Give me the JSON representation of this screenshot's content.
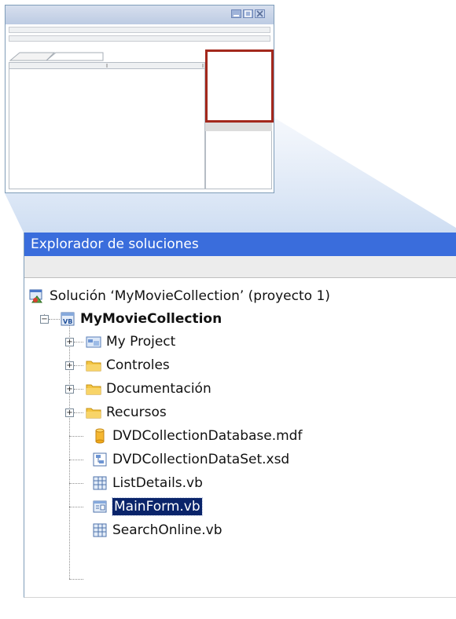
{
  "colors": {
    "title_bar": "#3a6ddc",
    "selection": "#0a246a",
    "highlight_frame": "#a3281c",
    "folder": "#f4c542"
  },
  "mini_window": {
    "controls": [
      "minimize-icon",
      "maximize-icon",
      "close-icon"
    ]
  },
  "solution_explorer": {
    "title": "Explorador de soluciones",
    "solution": {
      "label": "Solución ‘MyMovieCollection’ (proyecto 1)",
      "icon": "solution-icon"
    },
    "project": {
      "label": "MyMovieCollection",
      "icon": "vb-project-icon",
      "expanded": true
    },
    "items": [
      {
        "label": "My Project",
        "icon": "my-project-icon",
        "expandable": true
      },
      {
        "label": "Controles",
        "icon": "folder-icon",
        "expandable": true
      },
      {
        "label": "Documentación",
        "icon": "folder-icon",
        "expandable": true
      },
      {
        "label": "Recursos",
        "icon": "folder-icon",
        "expandable": true
      },
      {
        "label": "DVDCollectionDatabase.mdf",
        "icon": "database-icon",
        "expandable": false
      },
      {
        "label": "DVDCollectionDataSet.xsd",
        "icon": "dataset-icon",
        "expandable": false
      },
      {
        "label": "ListDetails.vb",
        "icon": "vb-form-icon",
        "expandable": false
      },
      {
        "label": "MainForm.vb",
        "icon": "vb-form-icon",
        "expandable": false,
        "selected": true
      },
      {
        "label": "SearchOnline.vb",
        "icon": "vb-form-icon",
        "expandable": false
      }
    ]
  }
}
